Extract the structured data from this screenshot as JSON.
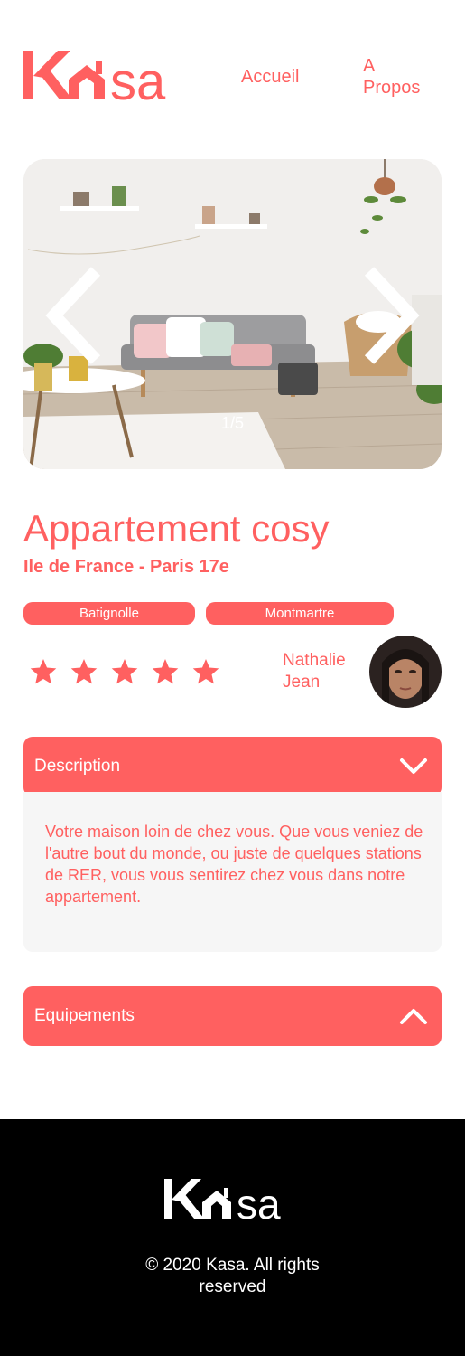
{
  "header": {
    "logo_text": "Kasa",
    "nav": {
      "home": "Accueil",
      "about_line1": "A",
      "about_line2": "Propos"
    }
  },
  "carousel": {
    "counter": "1/5",
    "prev_icon": "chevron-left-icon",
    "next_icon": "chevron-right-icon",
    "current": 1,
    "total": 5
  },
  "listing": {
    "title": "Appartement cosy",
    "location": "Ile de France - Paris 17e",
    "tags": [
      "Batignolle",
      "Montmartre"
    ],
    "rating": 5,
    "rating_max": 5,
    "host": {
      "first_name": "Nathalie",
      "last_name": "Jean"
    }
  },
  "collapses": {
    "description": {
      "label": "Description",
      "icon": "chevron-down-icon",
      "body": "Votre maison loin de chez vous. Que vous veniez de l'autre bout du monde, ou juste de quelques stations de RER, vous vous sentirez chez vous dans notre appartement."
    },
    "equipments": {
      "label": "Equipements",
      "icon": "chevron-up-icon"
    }
  },
  "footer": {
    "logo_text": "Kasa",
    "copyright_line1": "© 2020 Kasa. All rights",
    "copyright_line2": "reserved"
  },
  "colors": {
    "accent": "#FF6060",
    "footer_bg": "#000000",
    "panel_bg": "#F6F6F6"
  }
}
